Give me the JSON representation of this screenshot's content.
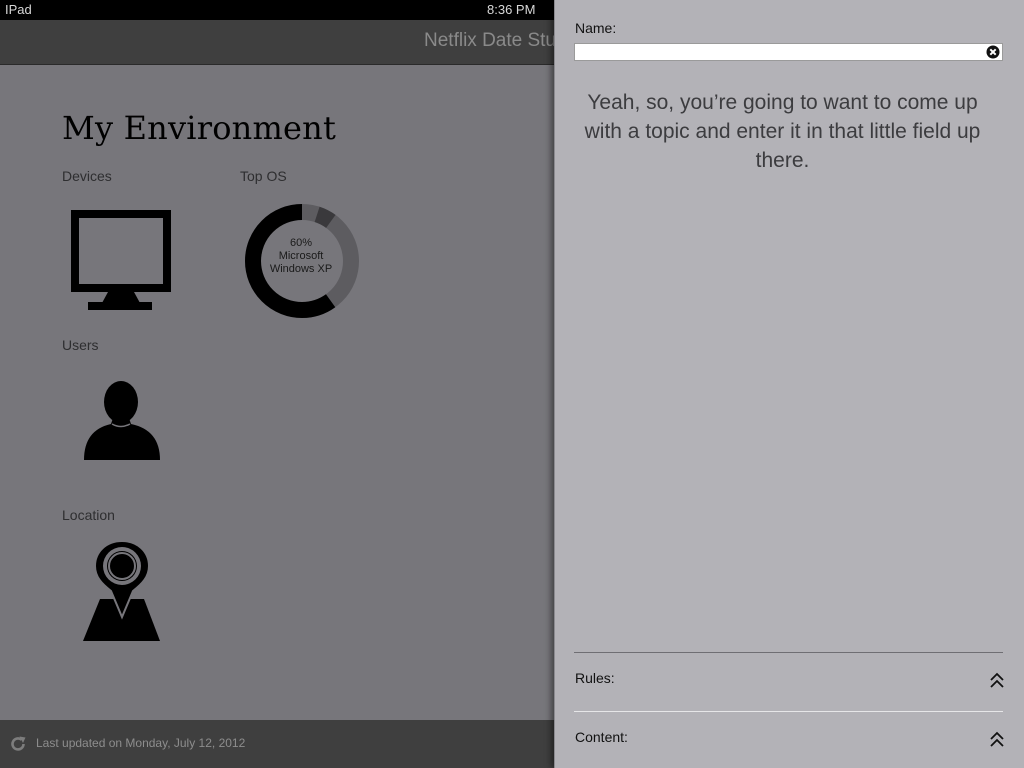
{
  "status_bar": {
    "device": "IPad",
    "time": "8:36 PM"
  },
  "title_bar": {
    "title": "Netflix Date Stu"
  },
  "main": {
    "title": "My Environment",
    "sections": {
      "devices": {
        "label": "Devices",
        "icon": "monitor-icon"
      },
      "top_os": {
        "label": "Top OS",
        "percent_text": "60%",
        "os_line1": "Microsoft",
        "os_line2": "Windows XP",
        "share": 0.6
      },
      "users": {
        "label": "Users",
        "icon": "user-icon"
      },
      "location": {
        "label": "Location",
        "icon": "map-pin-icon"
      }
    }
  },
  "footer": {
    "refresh_icon": "refresh-icon",
    "last_updated": "Last updated on Monday, July 12, 2012"
  },
  "panel": {
    "name_label": "Name:",
    "name_value": "",
    "clear_icon": "clear-circle-icon",
    "hint": "Yeah, so, you’re going to want to come up with a topic and enter it in that little field up there.",
    "rules_label": "Rules:",
    "content_label": "Content:",
    "expand_icon": "double-chevron-up-icon"
  },
  "colors": {
    "panel_bg": "#b3b2b7",
    "main_bg": "#77767b",
    "bar_bg": "#3f3f3f"
  }
}
